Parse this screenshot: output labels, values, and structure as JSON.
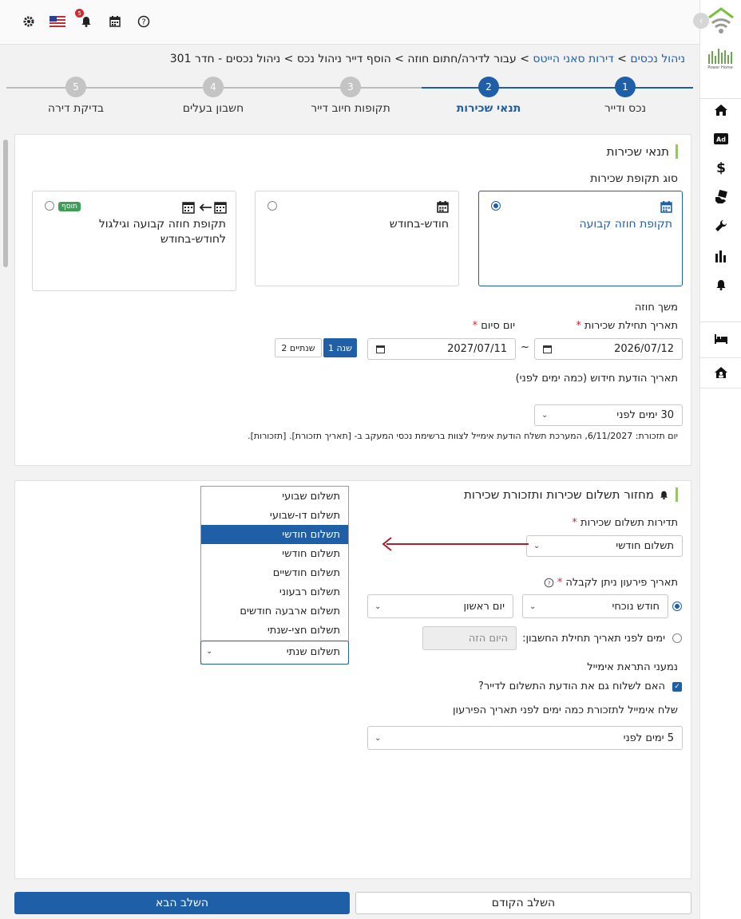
{
  "breadcrumb": {
    "l1": "ניהול נכסים",
    "l2": "דירות סאני הייטס",
    "rest": "> עבור לדירה/חתום חוזה > הוסף דייר ניהול נכס > ניהול נכסים - חדר 301"
  },
  "sidebar": {
    "logo_label": "Power Home",
    "ad_label": "Ad"
  },
  "steps": [
    {
      "num": "1",
      "label": "נכס ודייר"
    },
    {
      "num": "2",
      "label": "תנאי שכירות"
    },
    {
      "num": "3",
      "label": "תקופות חיוב דייר"
    },
    {
      "num": "4",
      "label": "חשבון בעלים"
    },
    {
      "num": "5",
      "label": "בדיקת דירה"
    }
  ],
  "lease": {
    "title": "תנאי שכירות",
    "period_type_label": "סוג תקופת שכירות",
    "options": {
      "fixed": "תקופת חוזה קבועה",
      "monthly": "חודש-בחודש",
      "rollover": "תקופת חוזה קבועה וגילגול לחודש-בחודש",
      "addon_badge": "תוסף"
    },
    "duration_label": "משך חוזה",
    "start_label": "תאריך תחילת שכירות",
    "end_label": "יום סיום",
    "start_value": "2026/07/12",
    "end_value": "2027/07/11",
    "range_sep": "~",
    "year1": "שנה 1",
    "year2": "שנתיים 2",
    "renewal_label": "תאריך הודעת חידוש (כמה ימים לפני)",
    "renewal_value": "30 ימים לפני",
    "reminder_text": "יום תזכורת: 6/11/2027, המערכת תשלח הודעת אימייל לצוות ברשימת נכסי המעקב ב- [תאריך תזכורת]. [תזכורות]."
  },
  "payment": {
    "title": "מחזור תשלום שכירות ותזכורת שכירות",
    "freq_label": "תדירות תשלום שכירות",
    "freq_value": "תשלום חודשי",
    "due_label": "תאריך פירעון ניתן לקבלה",
    "due_month": "חודש נוכחי",
    "due_day": "יום ראשון",
    "days_before_label": "ימים לפני תאריך תחילת החשבון:",
    "days_before_placeholder": "היום הזה",
    "email_recipients_label": "נמעני התראת אימייל",
    "send_tenant_label": "האם לשלוח גם את הודעת התשלום לדייר?",
    "send_days_label": "שלח אימייל לתזכורת כמה ימים לפני תאריך הפירעון",
    "send_days_value": "5 ימים לפני",
    "dropdown_options": [
      "תשלום שבועי",
      "תשלום דו-שבועי",
      "תשלום חודשי",
      "תשלום חודשי",
      "תשלום חודשיים",
      "תשלום רבעוני",
      "תשלום ארבעה חודשים",
      "תשלום חצי-שנתי"
    ],
    "dropdown_selected": "תשלום שנתי"
  },
  "buttons": {
    "next": "השלב הבא",
    "prev": "השלב הקודם"
  },
  "colors": {
    "primary": "#1f5fa8",
    "accent_green": "#9ac46c",
    "badge_green": "#3f9d57",
    "required_red": "#d9262f",
    "arrow_red": "#a8232b"
  }
}
